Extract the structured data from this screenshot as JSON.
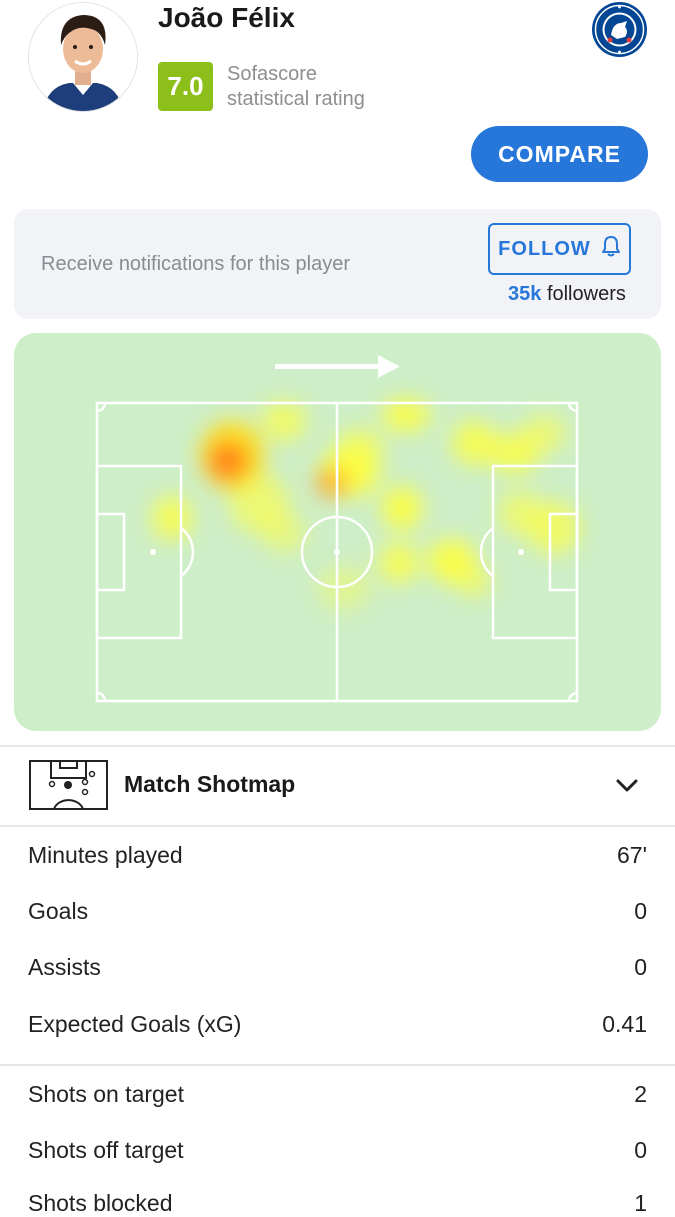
{
  "player": {
    "name": "João Félix",
    "rating": "7.0",
    "rating_caption_line1": "Sofascore",
    "rating_caption_line2": "statistical rating",
    "club_icon": "chelsea-crest-icon"
  },
  "actions": {
    "compare_label": "COMPARE",
    "follow_label": "FOLLOW",
    "follow_icon": "bell-icon"
  },
  "notifications": {
    "text": "Receive notifications for this player",
    "followers_count": "35k",
    "followers_label": "followers"
  },
  "heatmap": {
    "attack_direction": "right",
    "colors": {
      "pitch": "#cdeec8",
      "low": "#ffff3c",
      "high": "#ff7a1a"
    }
  },
  "shotmap": {
    "label": "Match Shotmap",
    "expanded": false
  },
  "stats_group1": [
    {
      "label": "Minutes played",
      "value": "67'"
    },
    {
      "label": "Goals",
      "value": "0"
    },
    {
      "label": "Assists",
      "value": "0"
    },
    {
      "label": "Expected Goals (xG)",
      "value": "0.41"
    }
  ],
  "stats_group2": [
    {
      "label": "Shots on target",
      "value": "2"
    },
    {
      "label": "Shots off target",
      "value": "0"
    },
    {
      "label": "Shots blocked",
      "value": "1"
    }
  ],
  "colors": {
    "accent": "#2677d9",
    "rating_badge": "#8dbf1a",
    "card_bg": "#f2f3f6"
  }
}
